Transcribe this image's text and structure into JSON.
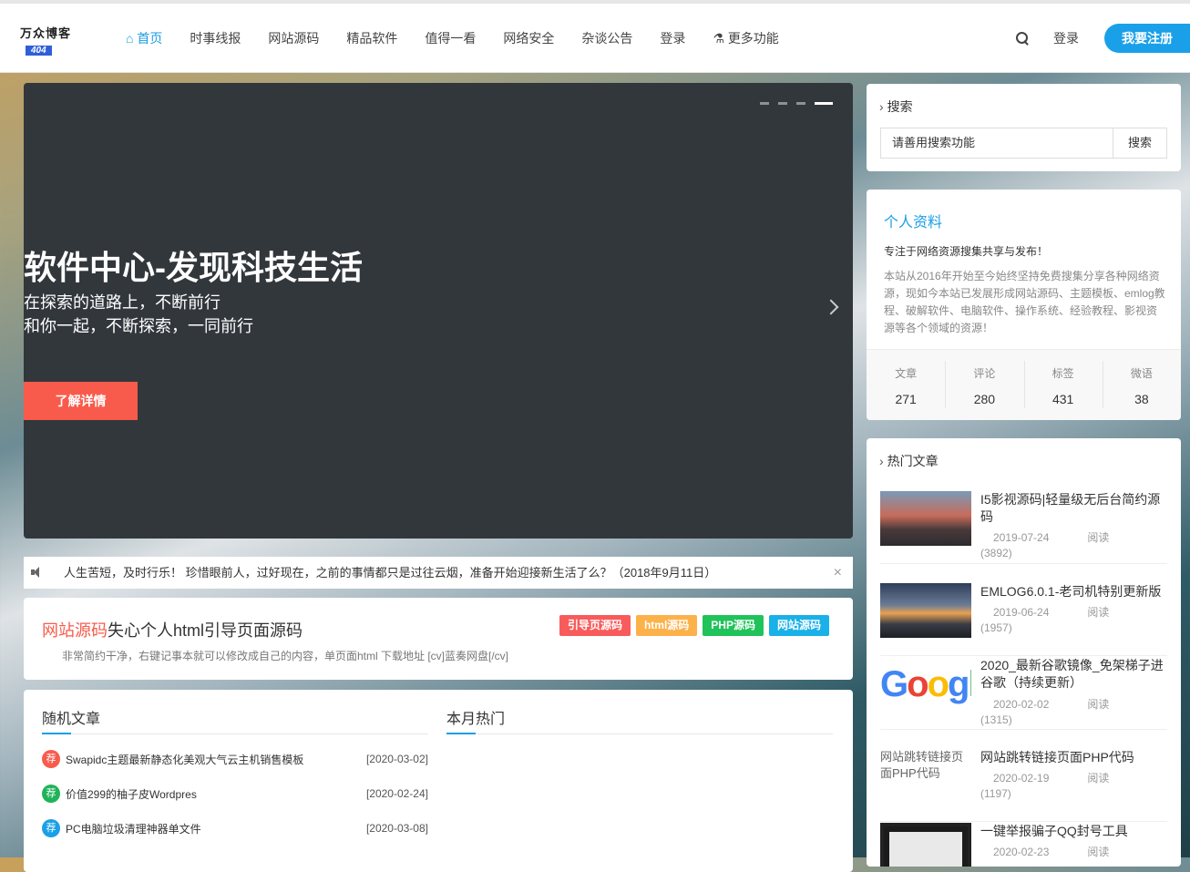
{
  "header": {
    "logo_line1": "万众博客",
    "logo_line2": "404",
    "nav": [
      {
        "label": "首页",
        "icon": "home-icon",
        "active": true
      },
      {
        "label": "时事线报"
      },
      {
        "label": "网站源码"
      },
      {
        "label": "精品软件"
      },
      {
        "label": "值得一看"
      },
      {
        "label": "网络安全"
      },
      {
        "label": "杂谈公告"
      },
      {
        "label": "登录"
      },
      {
        "label": "更多功能",
        "icon": "flask-icon"
      }
    ],
    "login_label": "登录",
    "register_label": "我要注册"
  },
  "slider": {
    "title": "软件中心-发现科技生活",
    "subtitle_line1": "在探索的道路上，不断前行",
    "subtitle_line2": "和你一起，不断探索，一同前行",
    "button_label": "了解详情"
  },
  "notice": {
    "text": "人生苦短，及时行乐！ 珍惜眼前人，过好现在，之前的事情都只是过往云烟，准备开始迎接新生活了么？（2018年9月11日）",
    "close": "×"
  },
  "featured": {
    "category": "网站源码",
    "title": "失心个人html引导页面源码",
    "description": "非常简约干净，右键记事本就可以修改成自己的内容，单页面html 下载地址 [cv]蓝奏网盘[/cv]",
    "tags": [
      {
        "label": "引导页源码",
        "color": "#f85b5b"
      },
      {
        "label": "html源码",
        "color": "#fcb24a"
      },
      {
        "label": "PHP源码",
        "color": "#1fc35a"
      },
      {
        "label": "网站源码",
        "color": "#1ab0e8"
      }
    ]
  },
  "random_articles": {
    "heading": "随机文章",
    "items": [
      {
        "badge": "荐",
        "badge_color": "#f85b4b",
        "title": "Swapidc主题最新静态化美观大气云主机销售模板",
        "date": "[2020-03-02]"
      },
      {
        "badge": "荐",
        "badge_color": "#1fb35a",
        "title": "价值299的柚子皮Wordpres",
        "date": "[2020-02-24]"
      },
      {
        "badge": "荐",
        "badge_color": "#1aa0e8",
        "title": "PC电脑垃圾清理神器单文件",
        "date": "[2020-03-08]"
      }
    ]
  },
  "monthly_hot": {
    "heading": "本月热门"
  },
  "sidebar": {
    "search": {
      "heading": "搜索",
      "value": "请善用搜索功能",
      "button": "搜索"
    },
    "profile": {
      "heading": "个人资料",
      "motto": "专注于网络资源搜集共享与发布！",
      "description": "本站从2016年开始至今始终坚持免费搜集分享各种网络资源，现如今本站已发展形成网站源码、主题模板、emlog教程、破解软件、电脑软件、操作系统、经验教程、影视资源等各个领域的资源！",
      "stats": [
        {
          "label": "文章",
          "value": "271"
        },
        {
          "label": "评论",
          "value": "280"
        },
        {
          "label": "标签",
          "value": "431"
        },
        {
          "label": "微语",
          "value": "38"
        }
      ]
    },
    "hot": {
      "heading": "热门文章",
      "items": [
        {
          "title": "I5影视源码|轻量级无后台简约源码",
          "date": "2019-07-24",
          "read": "阅读",
          "count": "(3892)"
        },
        {
          "title": "EMLOG6.0.1-老司机特别更新版",
          "date": "2019-06-24",
          "read": "阅读",
          "count": "(1957)"
        },
        {
          "title": "2020_最新谷歌镜像_免架梯子进谷歌（持续更新）",
          "date": "2020-02-02",
          "read": "阅读",
          "count": "(1315)",
          "thumb_text": "Google"
        },
        {
          "title": "网站跳转链接页面PHP代码",
          "date": "2020-02-19",
          "read": "阅读",
          "count": "(1197)",
          "thumb_alt": "网站跳转链接页面PHP代码"
        },
        {
          "title": "一键举报骗子QQ封号工具",
          "date": "2020-02-23",
          "read": "阅读"
        }
      ]
    }
  }
}
